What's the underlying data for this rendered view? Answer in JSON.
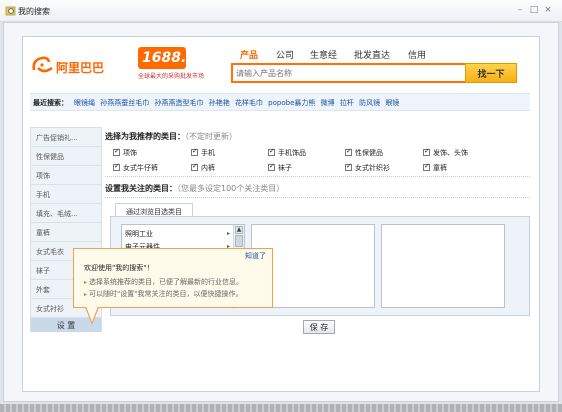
{
  "window": {
    "title": "我的搜索"
  },
  "header": {
    "brand_text": "阿里巴巴",
    "logo_1688": "1688.com",
    "logo_slogan": "全球最大的采购批发市场",
    "tabs": [
      "产品",
      "公司",
      "生意经",
      "批发直达",
      "信用"
    ],
    "search_placeholder": "请输入产品名称",
    "search_button": "找一下"
  },
  "recent": {
    "label": "最近搜索：",
    "items": [
      "眼镜绳",
      "孙燕燕蚕丝毛巾",
      "孙燕燕造型毛巾",
      "孙艳艳",
      "花样毛巾",
      "popobe暴力熊",
      "微博",
      "拉杆",
      "防风镜",
      "眼镜"
    ]
  },
  "sidebar": {
    "items": [
      "广告促销礼...",
      "性保健品",
      "项饰",
      "手机",
      "填充、毛绒...",
      "童裤",
      "女式毛衣",
      "袜子",
      "外套",
      "女式衬衫"
    ],
    "settings_label": "设 置"
  },
  "recommend": {
    "title": "选择为我推荐的类目：",
    "note": "（不定时更新）",
    "categories": [
      "项饰",
      "手机",
      "手机饰品",
      "性保健品",
      "发饰、头饰",
      "女式牛仔裤",
      "内裤",
      "袜子",
      "女式针织衫",
      "童裤"
    ]
  },
  "follow": {
    "title": "设置我关注的类目：",
    "note": "（您最多设定100个关注类目）",
    "browse_tab": "通过浏览目选类目",
    "list_items": [
      "照明工业",
      "电子元器件"
    ]
  },
  "save_button": "保 存",
  "tooltip": {
    "close": "知道了",
    "heading": "欢迎使用\"我的搜索\"！",
    "lines": [
      "选择系统推荐的类目，已便了解最新的行业信息。",
      "可以随时\"设置\"我常关注的类目，以便快捷操作。"
    ]
  },
  "colors": {
    "accent": "#ff6600",
    "link": "#1e50a2",
    "search_border": "#ff7300"
  }
}
